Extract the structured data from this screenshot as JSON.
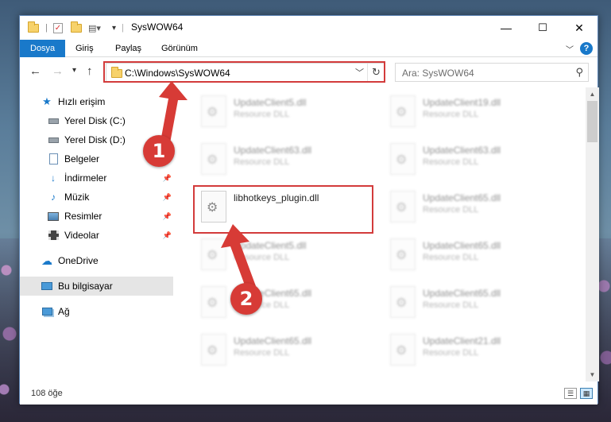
{
  "window": {
    "title": "SysWOW64",
    "controls": {
      "minimize": "—",
      "maximize": "☐",
      "close": "✕"
    }
  },
  "ribbon": {
    "tabs": [
      "Dosya",
      "Giriş",
      "Paylaş",
      "Görünüm"
    ],
    "active_tab": "Dosya",
    "help": "?"
  },
  "address_bar": {
    "path": "C:\\Windows\\SysWOW64"
  },
  "search": {
    "placeholder": "Ara: SysWOW64"
  },
  "sidebar": {
    "items": [
      {
        "label": "Hızlı erişim",
        "icon": "star-icon"
      },
      {
        "label": "Yerel Disk (C:)",
        "icon": "drive-icon"
      },
      {
        "label": "Yerel Disk (D:)",
        "icon": "drive-icon"
      },
      {
        "label": "Belgeler",
        "icon": "documents-icon"
      },
      {
        "label": "İndirmeler",
        "icon": "download-icon"
      },
      {
        "label": "Müzik",
        "icon": "music-icon"
      },
      {
        "label": "Resimler",
        "icon": "pictures-icon"
      },
      {
        "label": "Videolar",
        "icon": "video-icon"
      },
      {
        "label": "OneDrive",
        "icon": "cloud-icon"
      },
      {
        "label": "Bu bilgisayar",
        "icon": "computer-icon"
      },
      {
        "label": "Ağ",
        "icon": "network-icon"
      }
    ],
    "selected": "Bu bilgisayar"
  },
  "files": {
    "left": [
      {
        "name": "UpdateClient5.dll",
        "type": "Resource DLL"
      },
      {
        "name": "UpdateClient63.dll",
        "type": "Resource DLL"
      },
      {
        "name": "libhotkeys_plugin.dll",
        "type": ""
      },
      {
        "name": "UpdateClient5.dll",
        "type": "Resource DLL"
      },
      {
        "name": "UpdateClient65.dll",
        "type": "Resource DLL"
      },
      {
        "name": "UpdateClient65.dll",
        "type": "Resource DLL"
      }
    ],
    "right": [
      {
        "name": "UpdateClient19.dll",
        "type": "Resource DLL"
      },
      {
        "name": "UpdateClient63.dll",
        "type": "Resource DLL"
      },
      {
        "name": "UpdateClient65.dll",
        "type": "Resource DLL"
      },
      {
        "name": "UpdateClient65.dll",
        "type": "Resource DLL"
      },
      {
        "name": "UpdateClient65.dll",
        "type": "Resource DLL"
      },
      {
        "name": "UpdateClient21.dll",
        "type": "Resource DLL"
      }
    ]
  },
  "status_bar": {
    "item_count": "108 öğe"
  },
  "callouts": {
    "step1": "1",
    "step2": "2",
    "color": "#d73b36"
  }
}
